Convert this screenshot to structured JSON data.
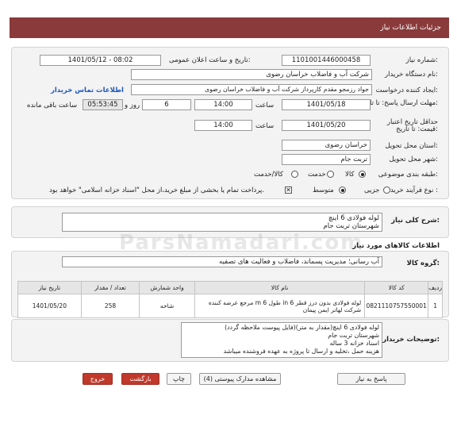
{
  "header": {
    "title": "جزئیات اطلاعات نیاز"
  },
  "form": {
    "need_number_label": "شماره نیاز:",
    "need_number": "1101001446000458",
    "announce_label": "تاریخ و ساعت اعلان عمومی:",
    "announce_value": "1401/05/12 - 08:02",
    "buyer_label": "نام دستگاه خریدار:",
    "buyer_value": "شرکت آب و فاضلاب خراسان رضوی",
    "creator_label": "ایجاد کننده درخواست:",
    "creator_value": "جواد رزمجو مقدم  کارپرداز شرکت آب و فاضلاب خراسان رضوی",
    "contact_link": "اطلاعات تماس خریدار",
    "deadline_label": "مهلت ارسال پاسخ: تا تاریخ:",
    "deadline_date": "1401/05/18",
    "time_label": "ساعت",
    "deadline_time": "14:00",
    "days_value": "6",
    "days_label": "روز و",
    "remaining_time": "05:53:45",
    "remaining_label": "ساعت باقی مانده",
    "validity_label": "حداقل تاریخ اعتبار قیمت: تا تاریخ:",
    "validity_date": "1401/05/20",
    "validity_time_label": "ساعت",
    "validity_time": "14:00",
    "province_label": "استان محل تحویل:",
    "province_value": "خراسان رضوی",
    "city_label": "شهر محل تحویل:",
    "city_value": "تربت جام",
    "category_label": "طبقه بندی موضوعی:",
    "category_options": [
      "کالا",
      "خدمت",
      "کالا/خدمت"
    ],
    "process_label": "نوع فرآیند خرید :",
    "process_options": [
      "جزیی",
      "متوسط"
    ],
    "payment_note": "پرداخت تمام یا بخشی از مبلغ خرید،از محل \"اسناد خزانه اسلامی\" خواهد بود."
  },
  "summary": {
    "label": "شرح کلی نیاز:",
    "line1": "لوله فولادی 6 اینچ",
    "line2": "شهرستان تربت جام"
  },
  "goods": {
    "title": "اطلاعات کالاهای مورد نیاز",
    "group_label": "گروه کالا:",
    "group_value": "آب رسانی؛ مدیریت پسماند، فاضلاب و فعالیت های تصفیه",
    "columns": [
      "ردیف",
      "کد کالا",
      "نام کالا",
      "واحد شمارش",
      "تعداد / مقدار",
      "تاریخ نیاز"
    ],
    "rows": [
      {
        "index": "1",
        "code": "0821110757550001",
        "name_line1": "لوله فولادی بدون درز قطر in 6 طول m 6 مرجع عرضه کننده",
        "name_line2": "شرکت لهاتر ایمن پیمان",
        "unit": "شاخه",
        "quantity": "258",
        "date": "1401/05/20"
      }
    ]
  },
  "buyer_notes": {
    "label": "توضیحات خریدار:",
    "lines": [
      "لوله فولادی 6 اینچ(مقدار به متر)(فایل پیوست ملاحظه گردد)",
      "شهرستان تربت جام",
      "اسناد خزانه 3 ساله",
      "هزینه حمل ،تخلیه و ارسال تا پروژه به عهده فروشنده میباشد"
    ]
  },
  "watermark": "ParsNamadari.com",
  "buttons": {
    "reply": "پاسخ به نیاز",
    "attachments": "مشاهده مدارک پیوستی (4)",
    "print": "چاپ",
    "back": "بازگشت",
    "exit": "خروج"
  }
}
